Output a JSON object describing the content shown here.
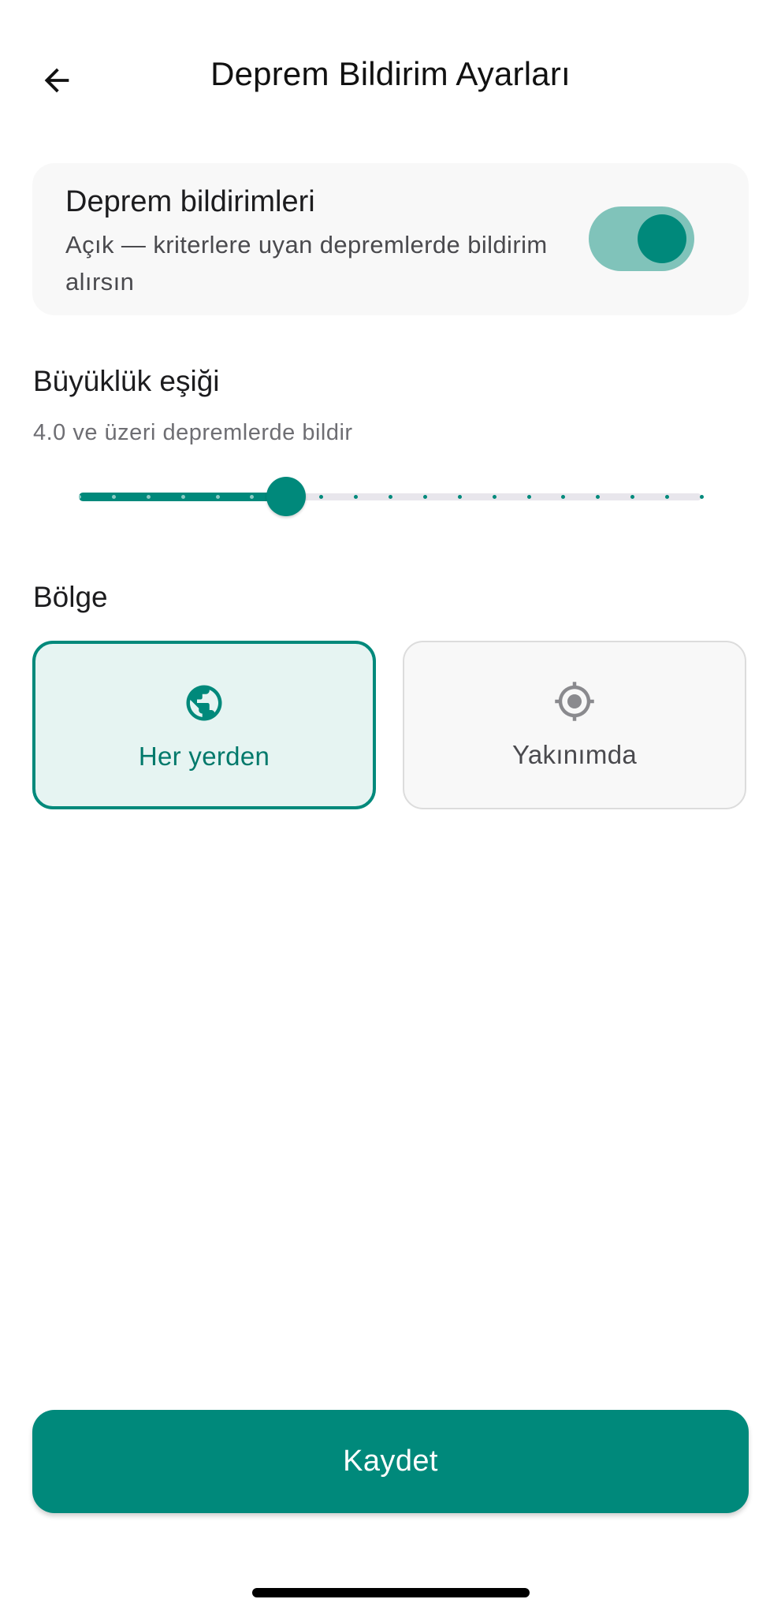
{
  "header": {
    "title": "Deprem Bildirim Ayarları",
    "back_icon": "arrow-left-icon"
  },
  "notifications": {
    "title": "Deprem bildirimleri",
    "description": "Açık — kriterlere uyan depremlerde bildirim alırsın",
    "enabled": true
  },
  "magnitude": {
    "title": "Büyüklük eşiği",
    "description": "4.0 ve üzeri depremlerde bildir",
    "slider": {
      "steps": 19,
      "selected_index": 6
    }
  },
  "region": {
    "title": "Bölge",
    "options": [
      {
        "label": "Her yerden",
        "icon": "globe-icon",
        "selected": true
      },
      {
        "label": "Yakınımda",
        "icon": "my-location-icon",
        "selected": false
      }
    ]
  },
  "save": {
    "label": "Kaydet"
  },
  "colors": {
    "accent": "#00897b",
    "accent_light": "#e6f4f2",
    "toggle_track": "#80c3ba",
    "card_bg": "#f8f8f8",
    "slider_inactive": "#e8e6ec"
  }
}
